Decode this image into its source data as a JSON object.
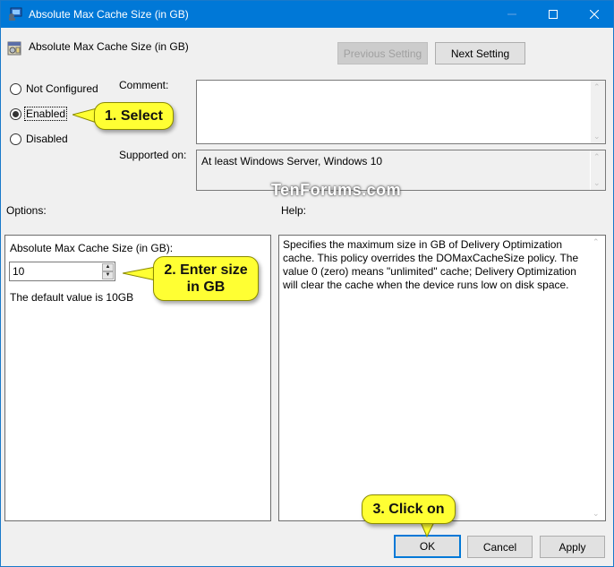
{
  "window": {
    "title": "Absolute Max Cache Size (in GB)",
    "controls": {
      "minimize": "minimize-icon",
      "maximize": "maximize-icon",
      "close": "close-icon"
    },
    "accent_color": "#0078d7"
  },
  "header": {
    "title": "Absolute Max Cache Size (in GB)",
    "previous_label": "Previous Setting",
    "next_label": "Next Setting"
  },
  "state": {
    "options": [
      {
        "label": "Not Configured",
        "selected": false
      },
      {
        "label": "Enabled",
        "selected": true
      },
      {
        "label": "Disabled",
        "selected": false
      }
    ]
  },
  "comment": {
    "label": "Comment:",
    "value": ""
  },
  "supported": {
    "label": "Supported on:",
    "value": "At least Windows Server, Windows 10"
  },
  "options_section": {
    "label": "Options:",
    "field_label": "Absolute Max Cache Size (in GB):",
    "field_value": "10",
    "default_note": "The default value is 10GB"
  },
  "help_section": {
    "label": "Help:",
    "text": "Specifies the maximum size in GB of Delivery Optimization cache. This policy overrides the DOMaxCacheSize policy. The value 0 (zero) means \"unlimited\" cache; Delivery Optimization will clear the cache when the device runs low on disk space."
  },
  "footer": {
    "ok_label": "OK",
    "cancel_label": "Cancel",
    "apply_label": "Apply"
  },
  "annotations": {
    "step1": "1. Select",
    "step2": "2. Enter size in GB",
    "step3": "3. Click on",
    "callout_color": "#ffff33",
    "watermark": "TenForums.com"
  }
}
